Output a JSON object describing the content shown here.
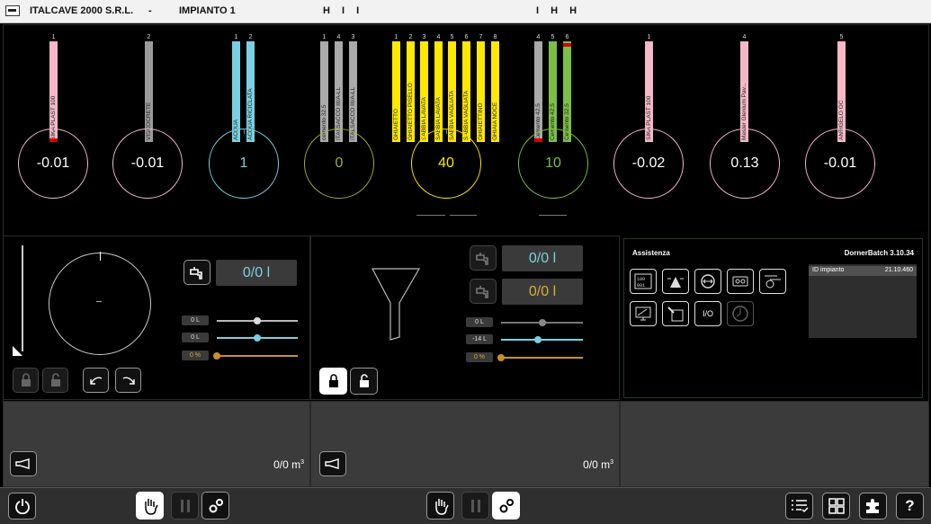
{
  "header": {
    "company": "ITALCAVE 2000 S.R.L.",
    "separator": "-",
    "plant": "IMPIANTO 1",
    "modes_left": "H I I",
    "modes_right": "I H H"
  },
  "silos": [
    {
      "num": "1",
      "label": "SIKA PLAST 100",
      "color": "#f4b8c8",
      "level_color": "#d00"
    },
    {
      "num": "2",
      "label": "VISCOCRETE",
      "color": "#9a9a9a",
      "level_color": ""
    },
    {
      "num": "1",
      "label": "ACQUA",
      "color": "#7ad0e0",
      "level_color": ""
    },
    {
      "num": "2",
      "label": "ACQUA RICICLATA",
      "color": "#7ad0e0",
      "level_color": ""
    },
    {
      "num": "1",
      "label": "cemento 32.5",
      "color": "#aaaaaa",
      "level_color": ""
    },
    {
      "num": "4",
      "label": "ITALSACCO III/A-LL",
      "color": "#aaaaaa",
      "level_color": ""
    },
    {
      "num": "3",
      "label": "ITALSACCO III/A-LL",
      "color": "#aaaaaa",
      "level_color": ""
    },
    {
      "num": "1",
      "label": "GHIAIETTO",
      "color": "#ffe800",
      "level_color": ""
    },
    {
      "num": "2",
      "label": "GHIAIETTO PISELLO",
      "color": "#ffe800",
      "level_color": ""
    },
    {
      "num": "3",
      "label": "SABBIA LAVATA",
      "color": "#ffe800",
      "level_color": ""
    },
    {
      "num": "4",
      "label": "SABBIA LAVATA",
      "color": "#ffe800",
      "level_color": ""
    },
    {
      "num": "5",
      "label": "SABBIA VAGLIATA",
      "color": "#ffe800",
      "level_color": ""
    },
    {
      "num": "6",
      "label": "SABBIA VAGLIATA",
      "color": "#ffe800",
      "level_color": ""
    },
    {
      "num": "7",
      "label": "GHIAIETTINO",
      "color": "#ffe800",
      "level_color": ""
    },
    {
      "num": "8",
      "label": "GHIAIA NOCE",
      "color": "#ffe800",
      "level_color": ""
    },
    {
      "num": "4",
      "label": "Cemento 42.5",
      "color": "#aaaaaa",
      "level_color": "#d00"
    },
    {
      "num": "5",
      "label": "Cemento 42.5",
      "color": "#7ac043",
      "level_color": ""
    },
    {
      "num": "6",
      "label": "Cemento 32.5",
      "color": "#7ac043",
      "level_color": "#d00"
    },
    {
      "num": "1",
      "label": "SIKA PLAST 100",
      "color": "#f4b8c8",
      "level_color": ""
    },
    {
      "num": "4",
      "label": "Master Glenium Pav...",
      "color": "#f4b8c8",
      "level_color": ""
    },
    {
      "num": "5",
      "label": "ANTIGELO OC",
      "color": "#f4b8c8",
      "level_color": ""
    }
  ],
  "scales": [
    {
      "value": "-0.01",
      "color": "#f4b8c8",
      "text_color": "#ffffff"
    },
    {
      "value": "-0.01",
      "color": "#f4b8c8",
      "text_color": "#ffffff"
    },
    {
      "value": "1",
      "color": "#7ad0e0",
      "text_color": "#7ad0e0"
    },
    {
      "value": "0",
      "color": "#9ab030",
      "text_color": "#9ab030"
    },
    {
      "value": "40",
      "color": "#ffe800",
      "text_color": "#ffe800"
    },
    {
      "value": "10",
      "color": "#7ac043",
      "text_color": "#7ac043"
    },
    {
      "value": "-0.02",
      "color": "#f4b8c8",
      "text_color": "#ffffff"
    },
    {
      "value": "0.13",
      "color": "#f4b8c8",
      "text_color": "#ffffff"
    },
    {
      "value": "-0.01",
      "color": "#f4b8c8",
      "text_color": "#ffffff"
    }
  ],
  "mixer_left": {
    "water_value": "0/0 l",
    "slider1_label": "0 L",
    "slider2_label": "0 L",
    "slider3_label": "0 %",
    "slider1_level": 0.5,
    "slider2_level": 0.5,
    "slider3_level": 0.0,
    "volume": "0/0 m",
    "volume_unit_sup": "3"
  },
  "mixer_right": {
    "water_value_1": "0/0 l",
    "water_value_2": "0/0 l",
    "slider1_label": "0 L",
    "slider2_label": "-14 L",
    "slider3_label": "0 %",
    "slider1_level": 0.5,
    "slider2_level": 0.45,
    "slider3_level": 0.0,
    "volume": "0/0 m",
    "volume_unit_sup": "3"
  },
  "assist": {
    "title": "Assistenza",
    "version": "DornerBatch 3.10.34",
    "id_label": "ID impianto",
    "id_value": "21.10.460",
    "io_label": "I/O"
  },
  "bottombar": {
    "help_label": "?"
  },
  "colors": {
    "cyan_value": "#7ad0e0",
    "yellow_value": "#d4b03a",
    "orange_slider": "#c8902a"
  }
}
